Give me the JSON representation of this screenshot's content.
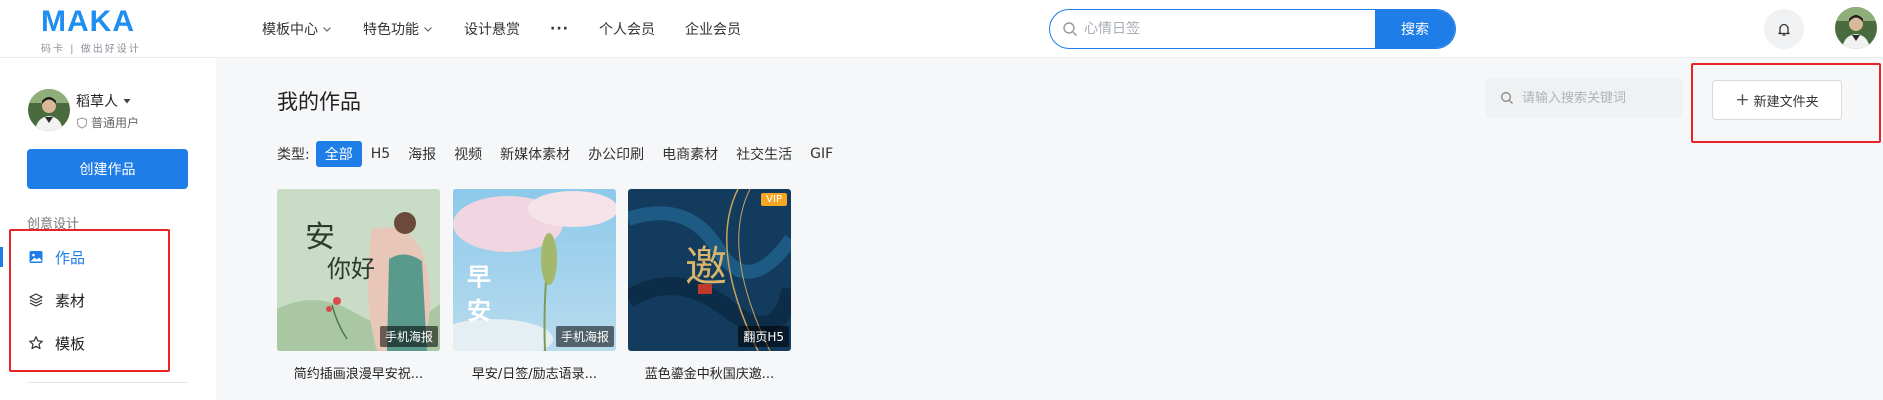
{
  "brand": {
    "name": "MAKA",
    "tagline": "码卡 | 做出好设计",
    "color": "#1f8ef1"
  },
  "nav": {
    "items": [
      {
        "label": "模板中心",
        "has_dropdown": true
      },
      {
        "label": "特色功能",
        "has_dropdown": true
      },
      {
        "label": "设计悬赏",
        "has_dropdown": false
      },
      {
        "label": "···",
        "has_dropdown": false
      },
      {
        "label": "个人会员",
        "has_dropdown": false
      },
      {
        "label": "企业会员",
        "has_dropdown": false
      }
    ]
  },
  "search": {
    "placeholder": "心情日签",
    "button_label": "搜索"
  },
  "user": {
    "name": "稻草人",
    "tier": "普通用户"
  },
  "sidebar": {
    "create_button": "创建作品",
    "section_label": "创意设计",
    "items": [
      {
        "label": "作品",
        "icon": "image-icon",
        "active": true
      },
      {
        "label": "素材",
        "icon": "layers-icon",
        "active": false
      },
      {
        "label": "模板",
        "icon": "star-icon",
        "active": false
      }
    ]
  },
  "main": {
    "title": "我的作品",
    "search_placeholder": "请输入搜索关键词",
    "new_folder": "新建文件夹",
    "type_label": "类型:",
    "types": [
      "全部",
      "H5",
      "海报",
      "视频",
      "新媒体素材",
      "办公印刷",
      "电商素材",
      "社交生活",
      "GIF"
    ],
    "active_type": "全部",
    "works": [
      {
        "title": "简约插画浪漫早安祝...",
        "tag": "手机海报",
        "thumb_text": "早安你好",
        "vip": false
      },
      {
        "title": "早安/日签/励志语录...",
        "tag": "手机海报",
        "thumb_text": "早安",
        "vip": false
      },
      {
        "title": "蓝色鎏金中秋国庆邀...",
        "tag": "翻页H5",
        "thumb_text": "",
        "vip": true,
        "vip_label": "VIP"
      }
    ]
  },
  "colors": {
    "accent": "#1f7de8",
    "highlight": "#e82424"
  }
}
